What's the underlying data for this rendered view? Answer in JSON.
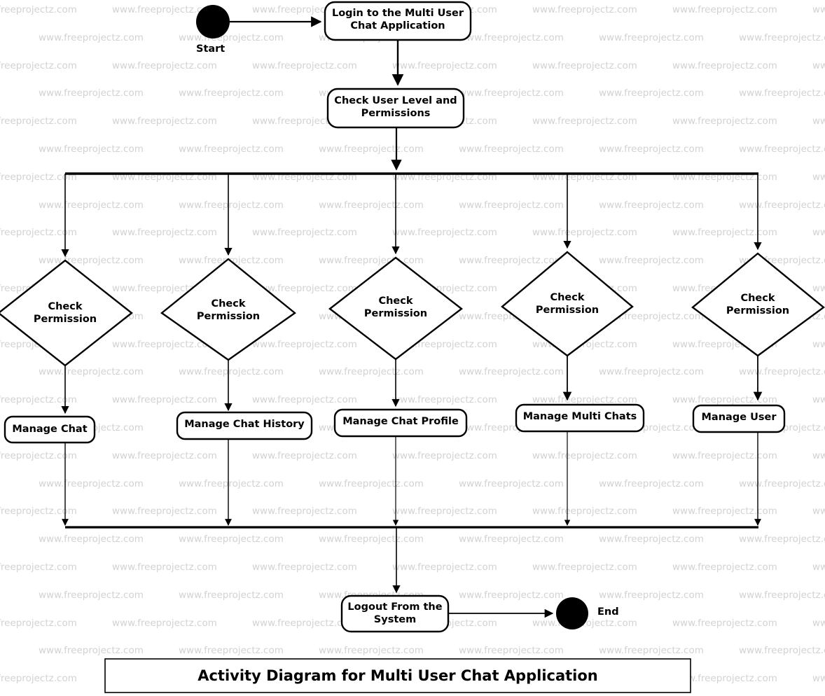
{
  "diagram": {
    "caption": "Activity Diagram for Multi User Chat Application",
    "start_label": "Start",
    "end_label": "End",
    "nodes": {
      "login": "Login to the Multi User\nChat Application",
      "check_user": "Check User Level and\nPermissions",
      "logout": "Logout From the\nSystem"
    },
    "decisions": [
      {
        "label": "Check\nPermission"
      },
      {
        "label": "Check\nPermission"
      },
      {
        "label": "Check\nPermission"
      },
      {
        "label": "Check\nPermission"
      },
      {
        "label": "Check\nPermission"
      }
    ],
    "activities": [
      {
        "label": "Manage Chat"
      },
      {
        "label": "Manage Chat History"
      },
      {
        "label": "Manage Chat Profile"
      },
      {
        "label": "Manage Multi Chats"
      },
      {
        "label": "Manage User"
      }
    ],
    "colors": {
      "stroke": "#000000",
      "fill": "#ffffff",
      "watermark": "#d2d2d2",
      "background": "#ffffff"
    },
    "watermark_text": "www.freeprojectz.com"
  }
}
